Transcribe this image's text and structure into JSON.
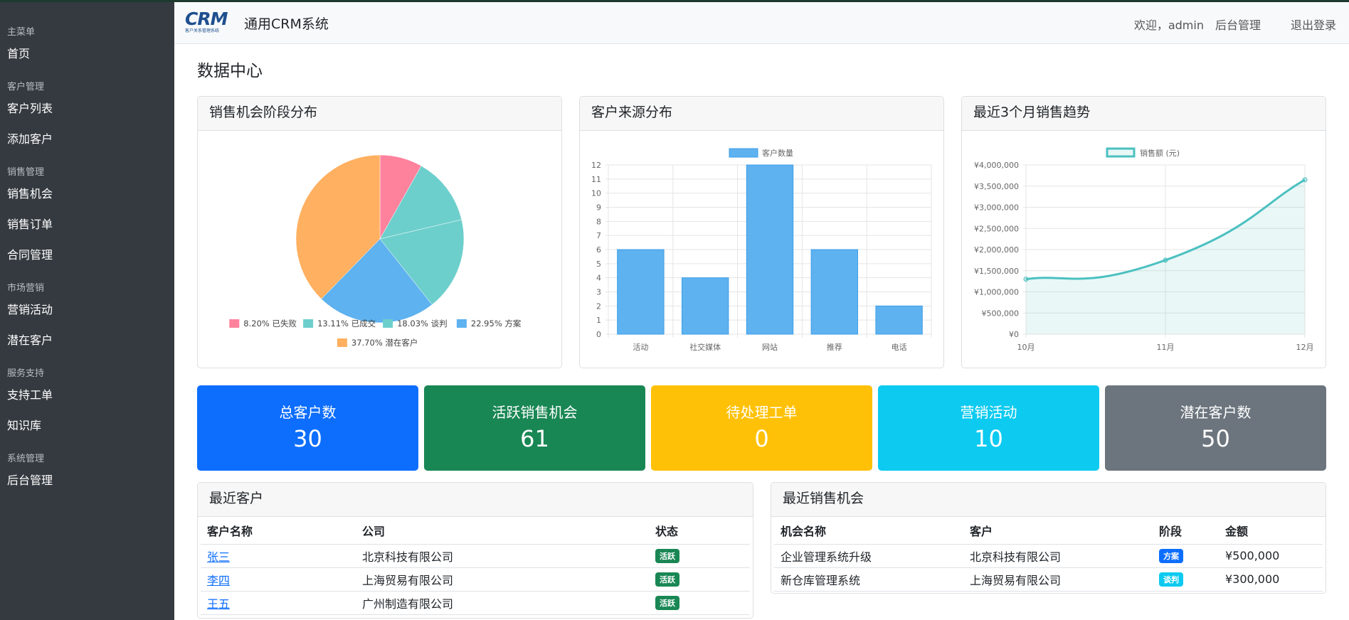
{
  "sidebar": {
    "items": [
      {
        "type": "section",
        "label": "主菜单"
      },
      {
        "type": "link",
        "label": "首页"
      },
      {
        "type": "section",
        "label": "客户管理"
      },
      {
        "type": "link",
        "label": "客户列表"
      },
      {
        "type": "link",
        "label": "添加客户"
      },
      {
        "type": "section",
        "label": "销售管理"
      },
      {
        "type": "link",
        "label": "销售机会"
      },
      {
        "type": "link",
        "label": "销售订单"
      },
      {
        "type": "link",
        "label": "合同管理"
      },
      {
        "type": "section",
        "label": "市场营销"
      },
      {
        "type": "link",
        "label": "营销活动"
      },
      {
        "type": "link",
        "label": "潜在客户"
      },
      {
        "type": "section",
        "label": "服务支持"
      },
      {
        "type": "link",
        "label": "支持工单"
      },
      {
        "type": "link",
        "label": "知识库"
      },
      {
        "type": "section",
        "label": "系统管理"
      },
      {
        "type": "link",
        "label": "后台管理"
      }
    ]
  },
  "header": {
    "logo_text": "CRM",
    "logo_subtext": "客户关系管理系统",
    "app_title": "通用CRM系统",
    "welcome": "欢迎，admin",
    "admin_link": "后台管理",
    "logout": "退出登录"
  },
  "page_title": "数据中心",
  "cards": {
    "pie_title": "销售机会阶段分布",
    "bar_title": "客户来源分布",
    "line_title": "最近3个月销售趋势"
  },
  "chart_data": [
    {
      "type": "pie",
      "title": "销售机会阶段分布",
      "labels": [
        "8.20% 已失败",
        "13.11% 已成交",
        "18.03% 谈判",
        "22.95% 方案",
        "37.70% 潜在客户"
      ],
      "values": [
        8.2,
        13.11,
        18.03,
        22.95,
        37.7
      ],
      "colors": [
        "#ff829d",
        "#6dcfcc",
        "#6dcfcc",
        "#5eb2ef",
        "#ffb060"
      ],
      "legend": "bottom"
    },
    {
      "type": "bar",
      "title": "客户来源分布",
      "categories": [
        "活动",
        "社交媒体",
        "网站",
        "推荐",
        "电话"
      ],
      "series": [
        {
          "name": "客户数量",
          "values": [
            6,
            4,
            12,
            6,
            2
          ]
        }
      ],
      "ylim": [
        0,
        12
      ],
      "yticks": [
        "0",
        "1",
        "2",
        "3",
        "4",
        "5",
        "6",
        "7",
        "8",
        "9",
        "10",
        "11",
        "12"
      ],
      "color": "#5eb2ef",
      "grid": true,
      "legend": "top"
    },
    {
      "type": "line",
      "title": "最近3个月销售趋势",
      "categories": [
        "10月",
        "11月",
        "12月"
      ],
      "series": [
        {
          "name": "销售额 (元)",
          "values": [
            1300000,
            1750000,
            3650000
          ]
        }
      ],
      "ylim": [
        0,
        4000000
      ],
      "yticks": [
        "¥0",
        "¥500,000",
        "¥1,000,000",
        "¥1,500,000",
        "¥2,000,000",
        "¥2,500,000",
        "¥3,000,000",
        "¥3,500,000",
        "¥4,000,000"
      ],
      "color": "#4bc0c0",
      "fill": true,
      "grid": true,
      "legend": "top"
    }
  ],
  "stats": [
    {
      "label": "总客户数",
      "value": "30",
      "color": "#0d6efd"
    },
    {
      "label": "活跃销售机会",
      "value": "61",
      "color": "#198754"
    },
    {
      "label": "待处理工单",
      "value": "0",
      "color": "#ffc107"
    },
    {
      "label": "营销活动",
      "value": "10",
      "color": "#0dcaf0"
    },
    {
      "label": "潜在客户数",
      "value": "50",
      "color": "#6c757d"
    }
  ],
  "recent_customers": {
    "title": "最近客户",
    "headers": [
      "客户名称",
      "公司",
      "状态"
    ],
    "rows": [
      {
        "name": "张三",
        "company": "北京科技有限公司",
        "status": "活跃"
      },
      {
        "name": "李四",
        "company": "上海贸易有限公司",
        "status": "活跃"
      },
      {
        "name": "王五",
        "company": "广州制造有限公司",
        "status": "活跃"
      }
    ]
  },
  "recent_opportunities": {
    "title": "最近销售机会",
    "headers": [
      "机会名称",
      "客户",
      "阶段",
      "金额"
    ],
    "rows": [
      {
        "name": "企业管理系统升级",
        "customer": "北京科技有限公司",
        "stage": "方案",
        "stage_color": "#0d6efd",
        "amount": "¥500,000"
      },
      {
        "name": "新仓库管理系统",
        "customer": "上海贸易有限公司",
        "stage": "谈判",
        "stage_color": "#0dcaf0",
        "amount": "¥300,000"
      }
    ]
  }
}
